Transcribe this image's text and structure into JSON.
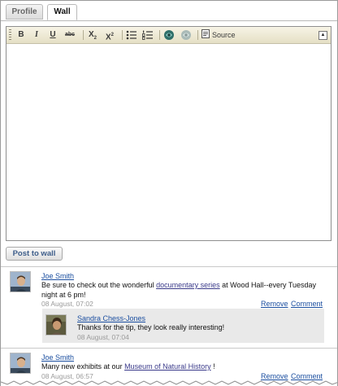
{
  "tabs": [
    {
      "label": "Profile",
      "active": false
    },
    {
      "label": "Wall",
      "active": true
    }
  ],
  "toolbar": {
    "bold": "B",
    "italic": "I",
    "underline": "U",
    "strike": "abc",
    "subscript_base": "X",
    "subscript_mark": "2",
    "superscript_base": "X",
    "superscript_mark": "2",
    "source_label": "Source",
    "icons": [
      "bold-icon",
      "italic-icon",
      "underline-icon",
      "strikethrough-icon",
      "subscript-icon",
      "superscript-icon",
      "bulleted-list-icon",
      "numbered-list-icon",
      "link-icon",
      "unlink-icon",
      "source-icon",
      "collapse-icon"
    ]
  },
  "post_button_label": "Post to wall",
  "posts": [
    {
      "author": "Joe Smith",
      "text_before": "Be sure to check out the wonderful ",
      "link_text": "documentary series",
      "text_after": " at Wood Hall--every Tuesday night at 6 pm!",
      "timestamp": "08 August, 07:02",
      "remove_label": "Remove",
      "comment_label": "Comment",
      "replies": [
        {
          "author": "Sandra Chess-Jones",
          "text": "Thanks for the tip, they look really interesting!",
          "timestamp": "08 August, 07:04"
        }
      ]
    },
    {
      "author": "Joe Smith",
      "text_before": "Many new exhibits at our ",
      "link_text": "Museum of Natural History",
      "text_after": " !",
      "timestamp": "08 August, 06:57",
      "remove_label": "Remove",
      "comment_label": "Comment"
    }
  ],
  "colors": {
    "link": "#1c4fa0",
    "toolbar_bg": "#ece8d4",
    "timestamp": "#9a9a9a",
    "reply_bg": "#e9e9e9"
  }
}
